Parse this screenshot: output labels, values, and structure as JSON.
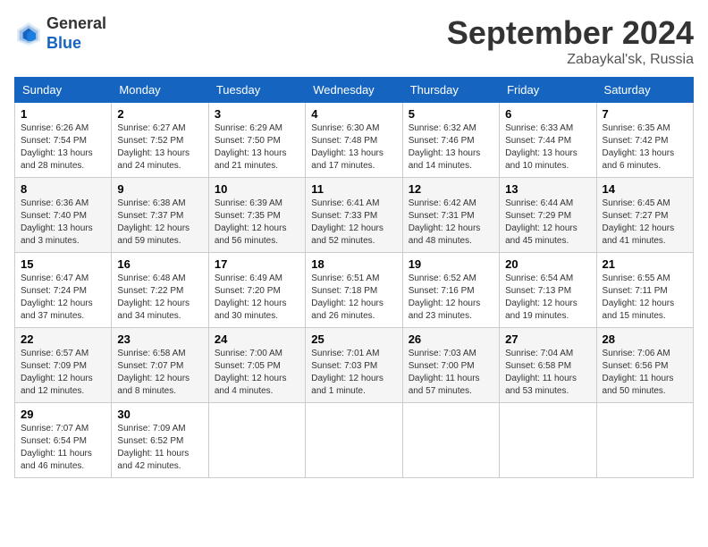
{
  "header": {
    "logo_general": "General",
    "logo_blue": "Blue",
    "month_title": "September 2024",
    "location": "Zabaykal'sk, Russia"
  },
  "weekdays": [
    "Sunday",
    "Monday",
    "Tuesday",
    "Wednesday",
    "Thursday",
    "Friday",
    "Saturday"
  ],
  "weeks": [
    [
      {
        "num": "1",
        "sunrise": "Sunrise: 6:26 AM",
        "sunset": "Sunset: 7:54 PM",
        "daylight": "Daylight: 13 hours and 28 minutes."
      },
      {
        "num": "2",
        "sunrise": "Sunrise: 6:27 AM",
        "sunset": "Sunset: 7:52 PM",
        "daylight": "Daylight: 13 hours and 24 minutes."
      },
      {
        "num": "3",
        "sunrise": "Sunrise: 6:29 AM",
        "sunset": "Sunset: 7:50 PM",
        "daylight": "Daylight: 13 hours and 21 minutes."
      },
      {
        "num": "4",
        "sunrise": "Sunrise: 6:30 AM",
        "sunset": "Sunset: 7:48 PM",
        "daylight": "Daylight: 13 hours and 17 minutes."
      },
      {
        "num": "5",
        "sunrise": "Sunrise: 6:32 AM",
        "sunset": "Sunset: 7:46 PM",
        "daylight": "Daylight: 13 hours and 14 minutes."
      },
      {
        "num": "6",
        "sunrise": "Sunrise: 6:33 AM",
        "sunset": "Sunset: 7:44 PM",
        "daylight": "Daylight: 13 hours and 10 minutes."
      },
      {
        "num": "7",
        "sunrise": "Sunrise: 6:35 AM",
        "sunset": "Sunset: 7:42 PM",
        "daylight": "Daylight: 13 hours and 6 minutes."
      }
    ],
    [
      {
        "num": "8",
        "sunrise": "Sunrise: 6:36 AM",
        "sunset": "Sunset: 7:40 PM",
        "daylight": "Daylight: 13 hours and 3 minutes."
      },
      {
        "num": "9",
        "sunrise": "Sunrise: 6:38 AM",
        "sunset": "Sunset: 7:37 PM",
        "daylight": "Daylight: 12 hours and 59 minutes."
      },
      {
        "num": "10",
        "sunrise": "Sunrise: 6:39 AM",
        "sunset": "Sunset: 7:35 PM",
        "daylight": "Daylight: 12 hours and 56 minutes."
      },
      {
        "num": "11",
        "sunrise": "Sunrise: 6:41 AM",
        "sunset": "Sunset: 7:33 PM",
        "daylight": "Daylight: 12 hours and 52 minutes."
      },
      {
        "num": "12",
        "sunrise": "Sunrise: 6:42 AM",
        "sunset": "Sunset: 7:31 PM",
        "daylight": "Daylight: 12 hours and 48 minutes."
      },
      {
        "num": "13",
        "sunrise": "Sunrise: 6:44 AM",
        "sunset": "Sunset: 7:29 PM",
        "daylight": "Daylight: 12 hours and 45 minutes."
      },
      {
        "num": "14",
        "sunrise": "Sunrise: 6:45 AM",
        "sunset": "Sunset: 7:27 PM",
        "daylight": "Daylight: 12 hours and 41 minutes."
      }
    ],
    [
      {
        "num": "15",
        "sunrise": "Sunrise: 6:47 AM",
        "sunset": "Sunset: 7:24 PM",
        "daylight": "Daylight: 12 hours and 37 minutes."
      },
      {
        "num": "16",
        "sunrise": "Sunrise: 6:48 AM",
        "sunset": "Sunset: 7:22 PM",
        "daylight": "Daylight: 12 hours and 34 minutes."
      },
      {
        "num": "17",
        "sunrise": "Sunrise: 6:49 AM",
        "sunset": "Sunset: 7:20 PM",
        "daylight": "Daylight: 12 hours and 30 minutes."
      },
      {
        "num": "18",
        "sunrise": "Sunrise: 6:51 AM",
        "sunset": "Sunset: 7:18 PM",
        "daylight": "Daylight: 12 hours and 26 minutes."
      },
      {
        "num": "19",
        "sunrise": "Sunrise: 6:52 AM",
        "sunset": "Sunset: 7:16 PM",
        "daylight": "Daylight: 12 hours and 23 minutes."
      },
      {
        "num": "20",
        "sunrise": "Sunrise: 6:54 AM",
        "sunset": "Sunset: 7:13 PM",
        "daylight": "Daylight: 12 hours and 19 minutes."
      },
      {
        "num": "21",
        "sunrise": "Sunrise: 6:55 AM",
        "sunset": "Sunset: 7:11 PM",
        "daylight": "Daylight: 12 hours and 15 minutes."
      }
    ],
    [
      {
        "num": "22",
        "sunrise": "Sunrise: 6:57 AM",
        "sunset": "Sunset: 7:09 PM",
        "daylight": "Daylight: 12 hours and 12 minutes."
      },
      {
        "num": "23",
        "sunrise": "Sunrise: 6:58 AM",
        "sunset": "Sunset: 7:07 PM",
        "daylight": "Daylight: 12 hours and 8 minutes."
      },
      {
        "num": "24",
        "sunrise": "Sunrise: 7:00 AM",
        "sunset": "Sunset: 7:05 PM",
        "daylight": "Daylight: 12 hours and 4 minutes."
      },
      {
        "num": "25",
        "sunrise": "Sunrise: 7:01 AM",
        "sunset": "Sunset: 7:03 PM",
        "daylight": "Daylight: 12 hours and 1 minute."
      },
      {
        "num": "26",
        "sunrise": "Sunrise: 7:03 AM",
        "sunset": "Sunset: 7:00 PM",
        "daylight": "Daylight: 11 hours and 57 minutes."
      },
      {
        "num": "27",
        "sunrise": "Sunrise: 7:04 AM",
        "sunset": "Sunset: 6:58 PM",
        "daylight": "Daylight: 11 hours and 53 minutes."
      },
      {
        "num": "28",
        "sunrise": "Sunrise: 7:06 AM",
        "sunset": "Sunset: 6:56 PM",
        "daylight": "Daylight: 11 hours and 50 minutes."
      }
    ],
    [
      {
        "num": "29",
        "sunrise": "Sunrise: 7:07 AM",
        "sunset": "Sunset: 6:54 PM",
        "daylight": "Daylight: 11 hours and 46 minutes."
      },
      {
        "num": "30",
        "sunrise": "Sunrise: 7:09 AM",
        "sunset": "Sunset: 6:52 PM",
        "daylight": "Daylight: 11 hours and 42 minutes."
      },
      null,
      null,
      null,
      null,
      null
    ]
  ]
}
